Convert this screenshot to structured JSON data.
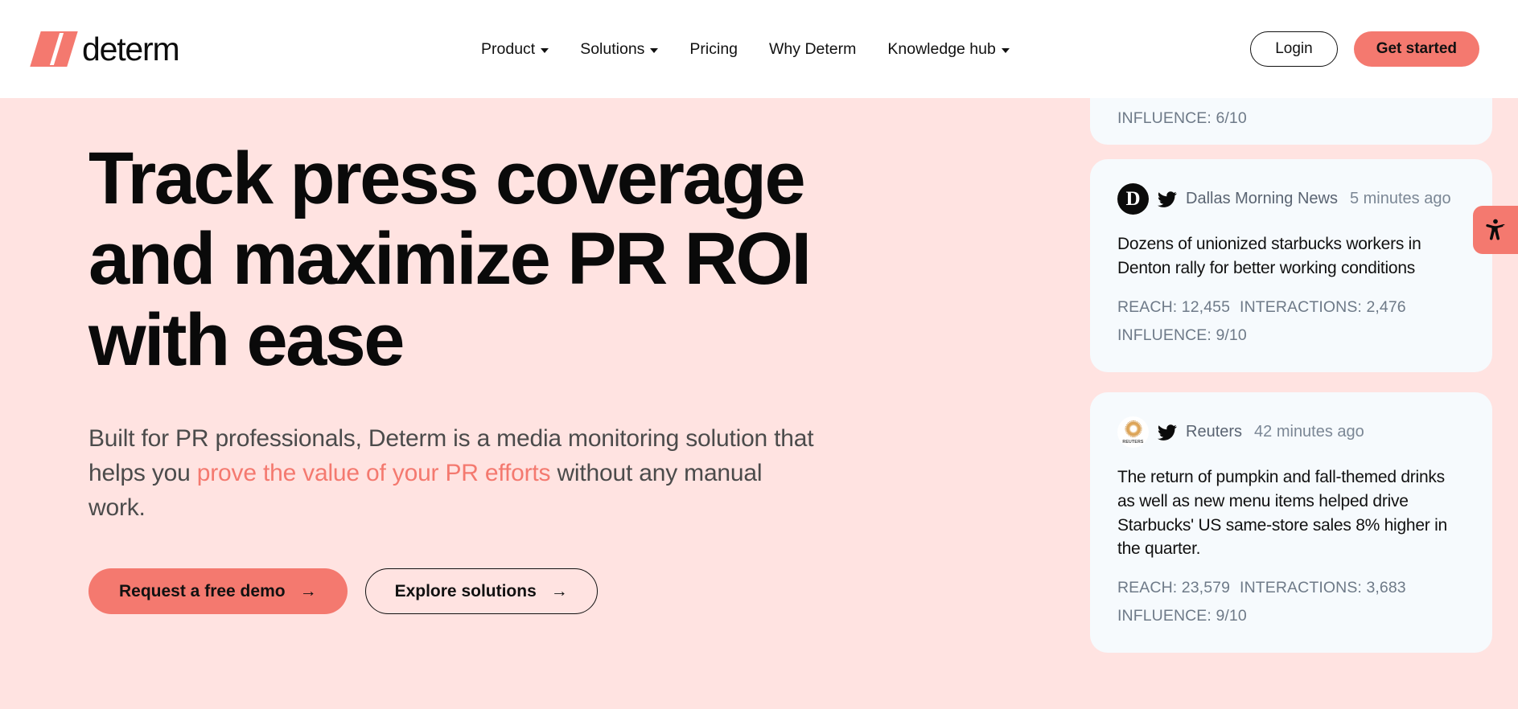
{
  "brand": {
    "name": "determ",
    "accent_color": "#F4796F",
    "hero_bg": "#FFE3E1",
    "card_bg": "#F6FAFD"
  },
  "header": {
    "nav": [
      {
        "label": "Product",
        "has_dropdown": true
      },
      {
        "label": "Solutions",
        "has_dropdown": true
      },
      {
        "label": "Pricing",
        "has_dropdown": false
      },
      {
        "label": "Why Determ",
        "has_dropdown": false
      },
      {
        "label": "Knowledge hub",
        "has_dropdown": true
      }
    ],
    "login_label": "Login",
    "get_started_label": "Get started"
  },
  "hero": {
    "headline_line1": "Track press coverage",
    "headline_line2": "and maximize PR ROI",
    "headline_line3": "with ease",
    "sub_part1": "Built for PR professionals, Determ is a media monitoring solution that helps you ",
    "sub_accent": "prove the value of your PR efforts",
    "sub_part2": " without any manual work.",
    "cta_primary": "Request a free demo",
    "cta_secondary": "Explore solutions",
    "arrow_glyph": "→"
  },
  "feed": {
    "partial_card": {
      "influence": "INFLUENCE: 6/10"
    },
    "cards": [
      {
        "avatar_letter": "D",
        "avatar_type": "dallas",
        "source": "Dallas Morning News",
        "time": "5 minutes ago",
        "headline": "Dozens of unionized starbucks workers in Denton rally for better working conditions",
        "reach": "REACH: 12,455",
        "interactions": "INTERACTIONS: 2,476",
        "influence": "INFLUENCE: 9/10"
      },
      {
        "avatar_letter": "",
        "avatar_type": "reuters",
        "avatar_word": "REUTERS",
        "source": "Reuters",
        "time": "42 minutes ago",
        "headline": "The return of pumpkin and fall-themed drinks as well as new menu items helped drive Starbucks' US same-store sales 8% higher in the quarter.",
        "reach": "REACH: 23,579",
        "interactions": "INTERACTIONS: 3,683",
        "influence": "INFLUENCE: 9/10"
      }
    ]
  },
  "accessibility_widget": {
    "icon": "accessibility-person-icon"
  }
}
